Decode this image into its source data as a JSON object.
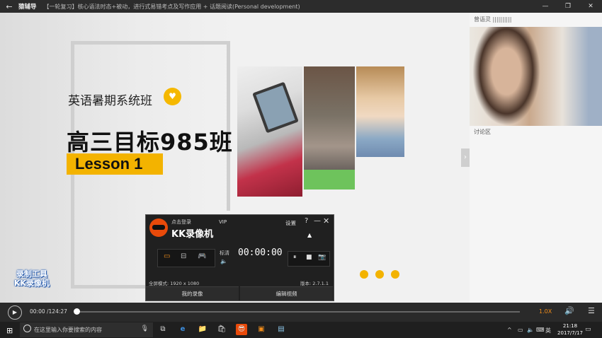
{
  "titlebar": {
    "back": "←",
    "app": "猿辅导",
    "course": "【一轮复习】核心语法时态+被动，进行式易错考点及写作应用 + 话题阅读(Personal development)",
    "minimize": "—",
    "restore": "❐",
    "close": "✕"
  },
  "slide": {
    "subtitle": "英语暑期系统班",
    "badge": "♥",
    "title": "高三目标985班",
    "lesson": "Lesson 1",
    "side_arrow": "›"
  },
  "watermark": {
    "line1": "录制工具",
    "line2": "KK录像机"
  },
  "right_panel": {
    "teacher": "曾语灵 ||||||||||",
    "discussion": "讨论区"
  },
  "player": {
    "play": "▶",
    "time": "00:00 /124:27",
    "progress": 0.0,
    "speed": "1.0X",
    "volume": "🔊",
    "menu": "☰"
  },
  "kk": {
    "login": "点击登录",
    "vip": "VIP",
    "brand": "KK录像机",
    "settings": "设置",
    "help": "?",
    "minimize": "—",
    "close": "✕",
    "modes": [
      "▭",
      "⊟",
      "🎮"
    ],
    "quality": "标清",
    "speaker": "🔈",
    "timer": "00:00:00",
    "pause": "⏸",
    "stop": "■",
    "camera": "📷",
    "fullscreen": "全屏模式: 1920 x 1080",
    "version": "版本: 2.7.1.1",
    "tab_left": "我的录像",
    "tab_right": "编辑视频"
  },
  "taskbar": {
    "start": "⊞",
    "search_placeholder": "在这里输入你要搜索的内容",
    "mic": "🎙",
    "apps": [
      "⧉",
      "e",
      "📁",
      "🛍",
      "😎",
      "▣",
      "▤"
    ],
    "tray_up": "^",
    "tray_icons": [
      "▭",
      "🔈",
      "⌨"
    ],
    "ime": "英",
    "time": "21:18",
    "date": "2017/7/17",
    "notification": "▭"
  }
}
